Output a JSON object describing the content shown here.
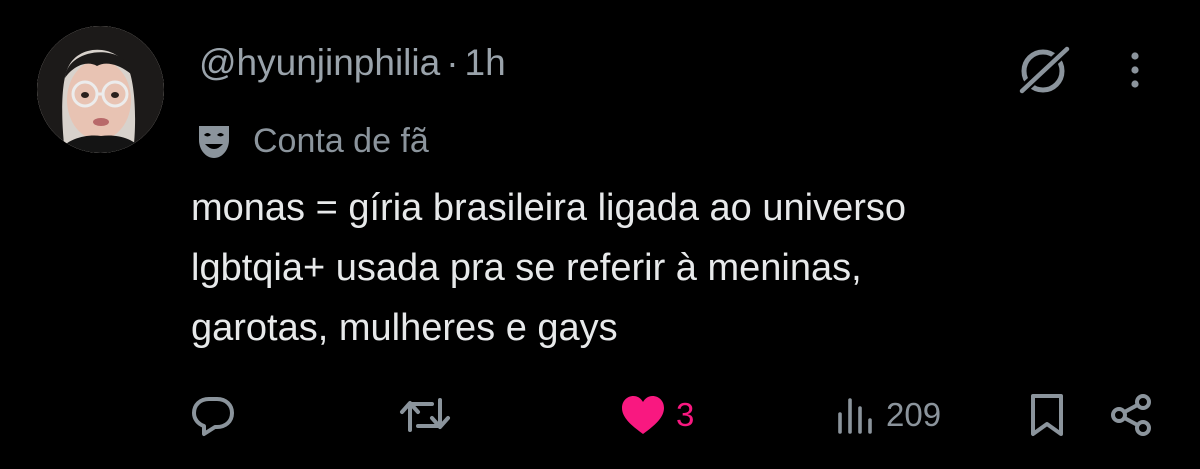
{
  "post": {
    "handle": "@hyunjinphilia",
    "separator": "·",
    "time": "1h",
    "badge_label": "Conta de fã",
    "text_lines": [
      "monas = gíria brasileira ligada ao universo",
      "lgbtqia+ usada pra se referir à meninas,",
      "garotas, mulheres e gays"
    ]
  },
  "actions": {
    "reply_icon": "speech-bubble-icon",
    "repost_icon": "repost-arrows-icon",
    "like_icon": "heart-icon",
    "like_count": "3",
    "views_icon": "bar-chart-icon",
    "views_count": "209",
    "bookmark_icon": "bookmark-icon",
    "share_icon": "share-icon"
  },
  "header_icons": {
    "grok": "grok-slash-circle-icon",
    "more": "more-dots-vertical-icon",
    "badge": "theater-mask-icon"
  },
  "colors": {
    "background": "#000000",
    "primary_text": "#e7e9ea",
    "secondary_text": "#8b949c",
    "like_active": "#f91880"
  }
}
